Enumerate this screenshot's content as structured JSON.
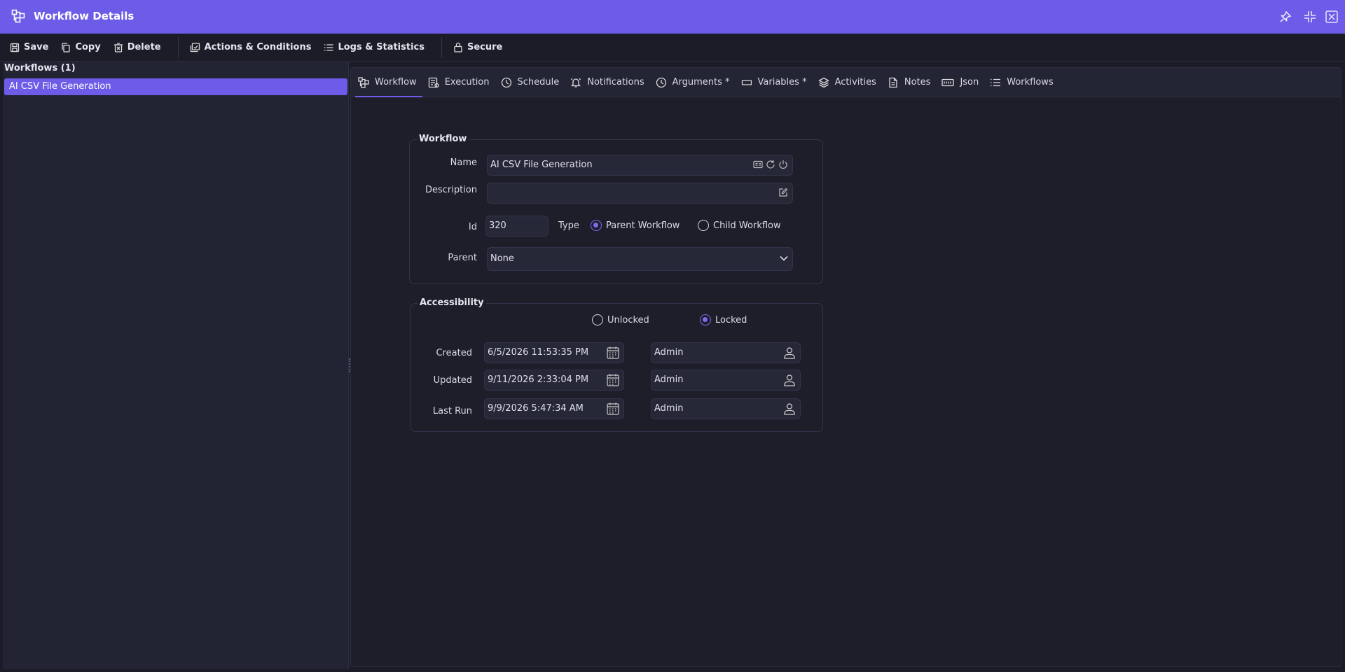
{
  "window": {
    "title": "Workflow Details"
  },
  "toolbar": {
    "save": "Save",
    "copy": "Copy",
    "delete": "Delete",
    "actions": "Actions & Conditions",
    "logs": "Logs & Statistics",
    "secure": "Secure"
  },
  "left": {
    "header": "Workflows (1)",
    "items": [
      "AI CSV File Generation"
    ]
  },
  "tabs": [
    {
      "label": "Workflow",
      "icon": "workflow-icon",
      "active": true
    },
    {
      "label": "Execution",
      "icon": "execution-icon"
    },
    {
      "label": "Schedule",
      "icon": "clock-icon"
    },
    {
      "label": "Notifications",
      "icon": "bell-icon"
    },
    {
      "label": "Arguments *",
      "icon": "clock-icon"
    },
    {
      "label": "Variables *",
      "icon": "rectangle-icon"
    },
    {
      "label": "Activities",
      "icon": "layers-icon"
    },
    {
      "label": "Notes",
      "icon": "document-icon"
    },
    {
      "label": "Json",
      "icon": "json-icon"
    },
    {
      "label": "Workflows",
      "icon": "list-icon"
    }
  ],
  "workflow_group": {
    "title": "Workflow",
    "name_label": "Name",
    "name_value": "AI CSV File Generation",
    "description_label": "Description",
    "description_value": "",
    "id_label": "Id",
    "id_value": "320",
    "type_label": "Type",
    "type_options": [
      "Parent Workflow",
      "Child Workflow"
    ],
    "type_selected": "Parent Workflow",
    "parent_label": "Parent",
    "parent_value": "None"
  },
  "access_group": {
    "title": "Accessibility",
    "lock_options": [
      "Unlocked",
      "Locked"
    ],
    "lock_selected": "Locked",
    "created_label": "Created",
    "created_value": "6/5/2026 11:53:35 PM",
    "created_by": "Admin",
    "updated_label": "Updated",
    "updated_value": "9/11/2026 2:33:04 PM",
    "updated_by": "Admin",
    "lastrun_label": "Last Run",
    "lastrun_value": "9/9/2026 5:47:34 AM",
    "lastrun_by": "Admin"
  },
  "colors": {
    "accent": "#6c5ce7",
    "background": "#1b1c27",
    "panel": "#222333"
  }
}
